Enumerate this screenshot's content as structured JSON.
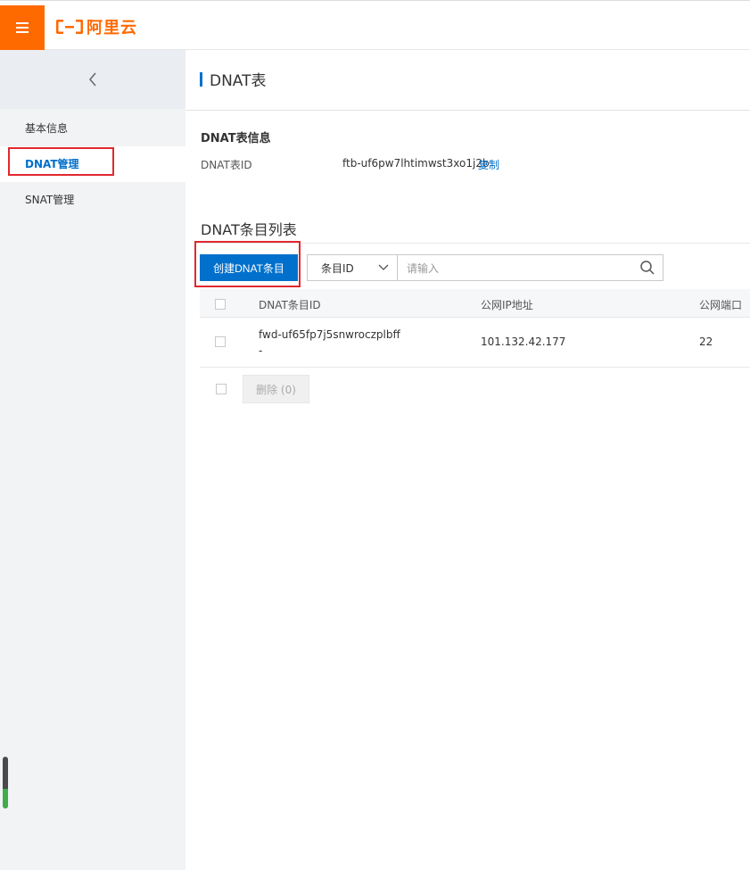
{
  "brand": {
    "logo_text": "阿里云",
    "accent": "#ff6a00"
  },
  "topbar": {
    "menu_icon": "menu-icon"
  },
  "sidebar": {
    "back_icon": "chevron-left-icon",
    "items": [
      {
        "label": "基本信息",
        "active": false
      },
      {
        "label": "DNAT管理",
        "active": true
      },
      {
        "label": "SNAT管理",
        "active": false
      }
    ]
  },
  "page": {
    "title": "DNAT表"
  },
  "info": {
    "section_title": "DNAT表信息",
    "id_label": "DNAT表ID",
    "id_value": "ftb-uf6pw7lhtimwst3xo1j2b",
    "copy_label": "复制"
  },
  "list": {
    "title": "DNAT条目列表",
    "create_button": "创建DNAT条目",
    "filter_select": "条目ID",
    "search_placeholder": "请输入",
    "columns": [
      "DNAT条目ID",
      "公网IP地址",
      "公网端口"
    ],
    "rows": [
      {
        "entry_id": "fwd-uf65fp7j5snwroczplbff",
        "entry_sub": "-",
        "public_ip": "101.132.42.177",
        "public_port": "22"
      }
    ],
    "delete_button": "删除 (0)"
  },
  "colors": {
    "primary": "#0070cc",
    "highlight": "#e0282e"
  }
}
